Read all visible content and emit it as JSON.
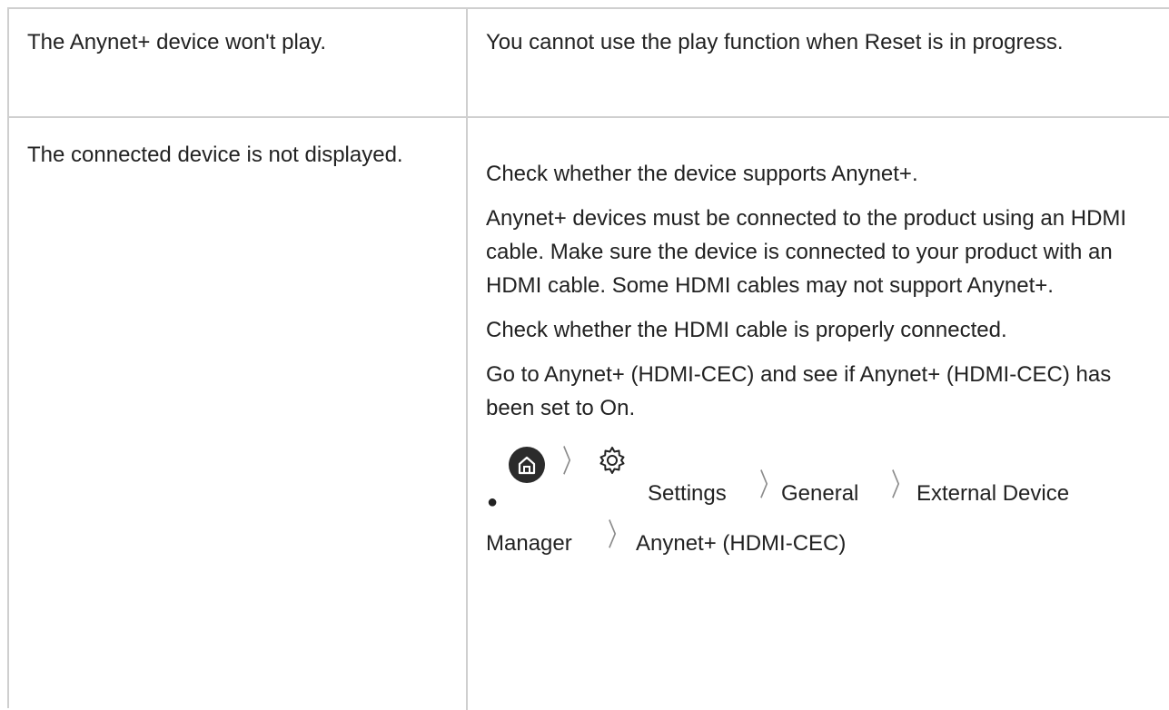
{
  "rows": [
    {
      "issue": "The Anynet+ device won't play.",
      "solution": "You cannot use the play function when Reset is in progress."
    },
    {
      "issue": "The connected device is not displayed.",
      "solutions": [
        "Check whether the device supports Anynet+.",
        "Anynet+ devices must be connected to the product using an HDMI cable. Make sure the device is connected to your product with an HDMI cable. Some HDMI cables may not support Anynet+.",
        "Check whether the HDMI cable is properly connected.",
        "Go to Anynet+ (HDMI-CEC) and see if Anynet+ (HDMI-CEC) has been set to On."
      ],
      "menu_path": {
        "bullet": "●",
        "home_icon": "home-icon",
        "settings_icon": "gear-icon",
        "settings": "Settings",
        "general": "General",
        "external_device_1": "External Device",
        "external_device_2": "Manager",
        "anynet": "Anynet+ (HDMI-CEC)"
      }
    }
  ],
  "colors": {
    "border": "#cfcfcf",
    "text": "#222222",
    "chevron": "#8c8c8c",
    "home_icon_bg": "#2b2b2b"
  }
}
